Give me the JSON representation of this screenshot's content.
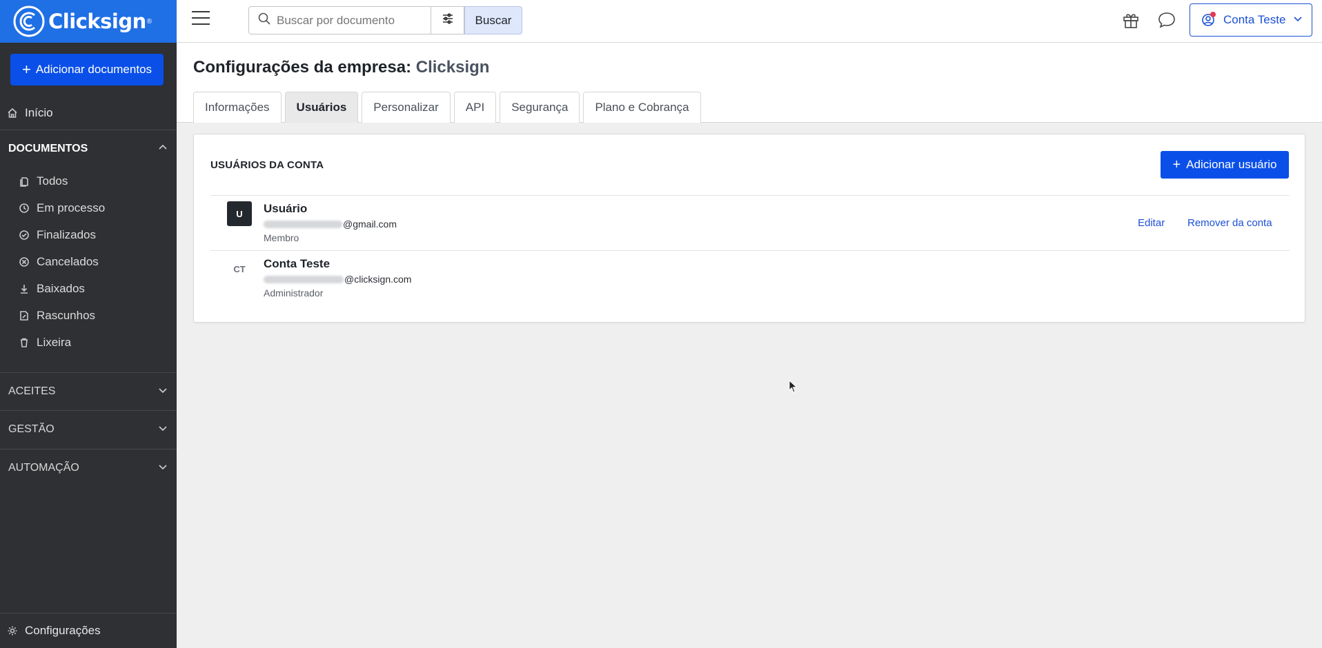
{
  "sidebar": {
    "brand": "Clicksign",
    "brand_tm": "®",
    "add_docs_label": "Adicionar documentos",
    "home_label": "Início",
    "documents_section": "DOCUMENTOS",
    "documents_items": [
      {
        "label": "Todos",
        "icon": "files-icon"
      },
      {
        "label": "Em processo",
        "icon": "clock-icon"
      },
      {
        "label": "Finalizados",
        "icon": "check-circle-icon"
      },
      {
        "label": "Cancelados",
        "icon": "x-circle-icon"
      },
      {
        "label": "Baixados",
        "icon": "download-icon"
      },
      {
        "label": "Rascunhos",
        "icon": "draft-icon"
      },
      {
        "label": "Lixeira",
        "icon": "trash-icon"
      }
    ],
    "sections": [
      "ACEITES",
      "GESTÃO",
      "AUTOMAÇÃO"
    ],
    "settings_label": "Configurações"
  },
  "topbar": {
    "search_placeholder": "Buscar por documento",
    "search_button": "Buscar",
    "account_label": "Conta Teste"
  },
  "page": {
    "title_prefix": "Configurações da empresa:",
    "company": "Clicksign",
    "tabs": [
      "Informações",
      "Usuários",
      "Personalizar",
      "API",
      "Segurança",
      "Plano e Cobrança"
    ],
    "active_tab": "Usuários"
  },
  "users_card": {
    "title": "USUÁRIOS DA CONTA",
    "add_button": "Adicionar usuário",
    "users": [
      {
        "initials": "U",
        "name": "Usuário",
        "email_domain": "@gmail.com",
        "role": "Membro",
        "edit_label": "Editar",
        "remove_label": "Remover da conta"
      },
      {
        "initials": "CT",
        "name": "Conta Teste",
        "email_domain": "@clicksign.com",
        "role": "Administrador"
      }
    ]
  },
  "colors": {
    "brand_blue": "#1f6fe5",
    "primary_button": "#0a4fe8",
    "link": "#1a4fd6",
    "sidebar_bg": "#2e3033",
    "notification_dot": "#e23a52"
  }
}
